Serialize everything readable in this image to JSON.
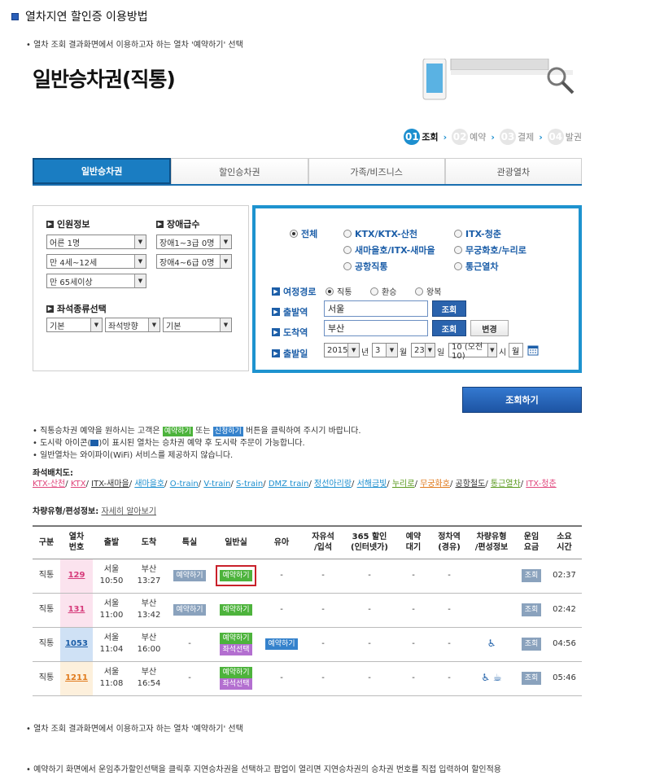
{
  "header": {
    "title": "열차지연 할인증 이용방법",
    "bullet1": "열차 조회 결과화면에서 이용하고자 하는 열차 '예약하기' 선택"
  },
  "page": {
    "big_title": "일반승차권(직통)"
  },
  "steps": [
    {
      "num": "01",
      "label": "조회"
    },
    {
      "num": "02",
      "label": "예약"
    },
    {
      "num": "03",
      "label": "결제"
    },
    {
      "num": "04",
      "label": "발권"
    }
  ],
  "tabs": [
    "일반승차권",
    "할인승차권",
    "가족/비즈니스",
    "관광열차"
  ],
  "left": {
    "people_title": "인원정보",
    "disability_title": "장애급수",
    "adult": "어른 1명",
    "child": "만 4세~12세",
    "senior": "만 65세이상",
    "dis1": "장애1~3급 0명",
    "dis2": "장애4~6급 0명",
    "seat_title": "좌석종류선택",
    "seat1": "기본",
    "seat2": "좌석방향",
    "seat3": "기본"
  },
  "right": {
    "types": [
      "전체",
      "KTX/KTX-산천",
      "ITX-청춘",
      "새마을호/ITX-새마을",
      "무궁화호/누리로",
      "공항직통",
      "통근열차"
    ],
    "route_label": "여정경로",
    "route_opts": [
      "직통",
      "환승",
      "왕복"
    ],
    "dep_label": "출발역",
    "dep_value": "서울",
    "arr_label": "도착역",
    "arr_value": "부산",
    "lookup": "조회",
    "change": "변경",
    "date_label": "출발일",
    "year": "2015",
    "y_unit": "년",
    "month": "3",
    "m_unit": "월",
    "day": "23",
    "d_unit": "일",
    "hour": "10 (오전10)",
    "h_unit": "시",
    "weekday": "월"
  },
  "search_button": "조회하기",
  "notes": {
    "n1a": "직통승차권 예약을 원하시는 고객은",
    "tag1": "예약하기",
    "n1b": "또는",
    "tag2": "신청하기",
    "n1c": "버튼을 클릭하여 주시기 바랍니다.",
    "n2a": "도시락 아이콘(",
    "n2b": ")이 표시된 열차는 승차권 예약 후 도시락 주문이 가능합니다.",
    "n3": "일반열차는 와이파이(WiFi) 서비스를 제공하지 않습니다."
  },
  "seat_layout": {
    "label": "좌석배치도:",
    "links": [
      {
        "t": "KTX-산천",
        "c": "#e0457b"
      },
      {
        "t": "KTX",
        "c": "#e0457b"
      },
      {
        "t": "ITX-새마을",
        "c": "#333333"
      },
      {
        "t": "새마을호",
        "c": "#1d8fcf"
      },
      {
        "t": "O-train",
        "c": "#1d8fcf"
      },
      {
        "t": "V-train",
        "c": "#1d8fcf"
      },
      {
        "t": "S-train",
        "c": "#1d8fcf"
      },
      {
        "t": "DMZ train",
        "c": "#1d8fcf"
      },
      {
        "t": "정선아리랑",
        "c": "#1d8fcf"
      },
      {
        "t": "서해금빛",
        "c": "#1d8fcf"
      },
      {
        "t": "누리로",
        "c": "#5a9a1e"
      },
      {
        "t": "무궁화호",
        "c": "#e07a1c"
      },
      {
        "t": "공항철도",
        "c": "#333333"
      },
      {
        "t": "통근열차",
        "c": "#5a9a1e"
      },
      {
        "t": "ITX-청춘",
        "c": "#e0457b"
      }
    ],
    "vehicle_label": "차량유형/편성정보:",
    "vehicle_link": "자세히 알아보기"
  },
  "table": {
    "headers": [
      "구분",
      "열차\n번호",
      "출발",
      "도착",
      "특실",
      "일반실",
      "유아",
      "자유석\n/입석",
      "365 할인\n(인터넷가)",
      "예약\n대기",
      "정차역\n(경유)",
      "차량유형\n/편성정보",
      "운임\n요금",
      "소요\n시간"
    ],
    "rows": [
      {
        "kind": "직통",
        "no": "129",
        "no_bg": "#fbe3ee",
        "no_color": "#d63a7a",
        "dep": "서울",
        "dep_t": "10:50",
        "arr": "부산",
        "arr_t": "13:27",
        "premium": "예약하기",
        "general": [
          "예약하기"
        ],
        "infant": "-",
        "free": "-",
        "d365": "-",
        "wait": "-",
        "stops": "-",
        "vehicle": "",
        "fare": "조회",
        "time": "02:37",
        "highlight": true
      },
      {
        "kind": "직통",
        "no": "131",
        "no_bg": "#fbe3ee",
        "no_color": "#d63a7a",
        "dep": "서울",
        "dep_t": "11:00",
        "arr": "부산",
        "arr_t": "13:42",
        "premium": "예약하기",
        "general": [
          "예약하기"
        ],
        "infant": "-",
        "free": "-",
        "d365": "-",
        "wait": "-",
        "stops": "-",
        "vehicle": "",
        "fare": "조회",
        "time": "02:42",
        "highlight": false
      },
      {
        "kind": "직통",
        "no": "1053",
        "no_bg": "#cfe1f5",
        "no_color": "#1c5ea8",
        "dep": "서울",
        "dep_t": "11:04",
        "arr": "부산",
        "arr_t": "16:00",
        "premium": "-",
        "general": [
          "예약하기",
          "좌석선택"
        ],
        "infant": "예약하기",
        "free": "-",
        "d365": "-",
        "wait": "-",
        "stops": "-",
        "vehicle": "♿",
        "fare": "조회",
        "time": "04:56",
        "highlight": false
      },
      {
        "kind": "직통",
        "no": "1211",
        "no_bg": "#fdf0dc",
        "no_color": "#e07a1c",
        "dep": "서울",
        "dep_t": "11:08",
        "arr": "부산",
        "arr_t": "16:54",
        "premium": "-",
        "general": [
          "예약하기",
          "좌석선택"
        ],
        "infant": "-",
        "free": "-",
        "d365": "-",
        "wait": "-",
        "stops": "-",
        "vehicle": "♿ ☕",
        "fare": "조회",
        "time": "05:46",
        "highlight": false
      }
    ]
  },
  "footer": {
    "line1": "열차 조회 결과화면에서 이용하고자 하는 열차 '예약하기' 선택",
    "line2": "예약하기 화면에서 운임추가할인선택을 클릭후 지연승차권을 선택하고 팝업이 열리면 지연승차권의 승차권 번호를 직접 입력하여 할인적용"
  }
}
